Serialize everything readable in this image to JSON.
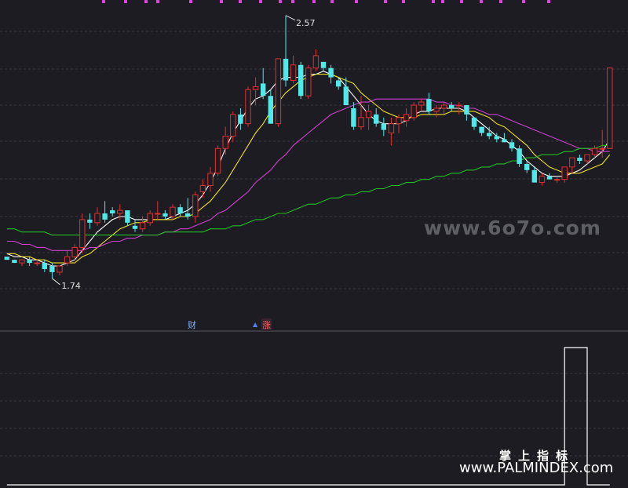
{
  "chart_data": {
    "type": "candlestick",
    "title": "",
    "price_range": [
      1.58,
      2.62
    ],
    "annotations": {
      "high": "2.57",
      "low": "1.74",
      "tags": [
        "财",
        "涨"
      ]
    },
    "candles": [
      [
        1.79,
        1.79,
        1.78,
        1.78
      ],
      [
        1.78,
        1.78,
        1.77,
        1.77
      ],
      [
        1.77,
        1.78,
        1.76,
        1.78
      ],
      [
        1.78,
        1.79,
        1.76,
        1.77
      ],
      [
        1.77,
        1.78,
        1.76,
        1.77
      ],
      [
        1.77,
        1.78,
        1.74,
        1.75
      ],
      [
        1.76,
        1.77,
        1.72,
        1.74
      ],
      [
        1.74,
        1.76,
        1.73,
        1.76
      ],
      [
        1.77,
        1.81,
        1.76,
        1.79
      ],
      [
        1.79,
        1.83,
        1.78,
        1.82
      ],
      [
        1.82,
        1.93,
        1.8,
        1.91
      ],
      [
        1.91,
        1.93,
        1.88,
        1.9
      ],
      [
        1.9,
        1.95,
        1.89,
        1.93
      ],
      [
        1.93,
        1.97,
        1.9,
        1.91
      ],
      [
        1.94,
        1.95,
        1.92,
        1.93
      ],
      [
        1.93,
        1.96,
        1.91,
        1.94
      ],
      [
        1.94,
        1.94,
        1.89,
        1.9
      ],
      [
        1.89,
        1.91,
        1.87,
        1.88
      ],
      [
        1.88,
        1.92,
        1.87,
        1.9
      ],
      [
        1.9,
        1.94,
        1.89,
        1.93
      ],
      [
        1.93,
        1.97,
        1.91,
        1.93
      ],
      [
        1.93,
        1.94,
        1.91,
        1.92
      ],
      [
        1.92,
        1.96,
        1.91,
        1.95
      ],
      [
        1.95,
        1.96,
        1.92,
        1.93
      ],
      [
        1.93,
        1.98,
        1.91,
        1.92
      ],
      [
        1.92,
        2.0,
        1.9,
        1.99
      ],
      [
        2.0,
        2.04,
        1.98,
        2.02
      ],
      [
        2.02,
        2.08,
        2.0,
        2.06
      ],
      [
        2.06,
        2.15,
        2.05,
        2.14
      ],
      [
        2.14,
        2.21,
        2.12,
        2.18
      ],
      [
        2.18,
        2.26,
        2.16,
        2.25
      ],
      [
        2.25,
        2.27,
        2.2,
        2.22
      ],
      [
        2.22,
        2.34,
        2.21,
        2.33
      ],
      [
        2.33,
        2.37,
        2.28,
        2.34
      ],
      [
        2.35,
        2.4,
        2.3,
        2.31
      ],
      [
        2.31,
        2.33,
        2.22,
        2.22
      ],
      [
        2.22,
        2.43,
        2.21,
        2.43
      ],
      [
        2.43,
        2.57,
        2.34,
        2.36
      ],
      [
        2.36,
        2.44,
        2.35,
        2.41
      ],
      [
        2.41,
        2.42,
        2.3,
        2.31
      ],
      [
        2.31,
        2.41,
        2.3,
        2.4
      ],
      [
        2.4,
        2.46,
        2.39,
        2.44
      ],
      [
        2.42,
        2.4,
        2.39,
        2.4
      ],
      [
        2.4,
        2.41,
        2.35,
        2.37
      ],
      [
        2.36,
        2.37,
        2.33,
        2.34
      ],
      [
        2.34,
        2.37,
        2.28,
        2.28
      ],
      [
        2.27,
        2.29,
        2.2,
        2.21
      ],
      [
        2.21,
        2.31,
        2.2,
        2.24
      ],
      [
        2.24,
        2.28,
        2.2,
        2.26
      ],
      [
        2.25,
        2.27,
        2.21,
        2.22
      ],
      [
        2.22,
        2.24,
        2.18,
        2.2
      ],
      [
        2.19,
        2.24,
        2.15,
        2.22
      ],
      [
        2.22,
        2.25,
        2.19,
        2.24
      ],
      [
        2.23,
        2.27,
        2.21,
        2.25
      ],
      [
        2.24,
        2.29,
        2.23,
        2.28
      ],
      [
        2.28,
        2.3,
        2.26,
        2.29
      ],
      [
        2.3,
        2.32,
        2.25,
        2.26
      ],
      [
        2.26,
        2.28,
        2.24,
        2.27
      ],
      [
        2.27,
        2.29,
        2.25,
        2.28
      ],
      [
        2.28,
        2.29,
        2.26,
        2.27
      ],
      [
        2.28,
        2.29,
        2.25,
        2.28
      ],
      [
        2.28,
        2.28,
        2.23,
        2.25
      ],
      [
        2.24,
        2.24,
        2.2,
        2.21
      ],
      [
        2.21,
        2.21,
        2.18,
        2.19
      ],
      [
        2.19,
        2.21,
        2.17,
        2.18
      ],
      [
        2.18,
        2.19,
        2.16,
        2.17
      ],
      [
        2.17,
        2.19,
        2.16,
        2.16
      ],
      [
        2.16,
        2.17,
        2.13,
        2.14
      ],
      [
        2.14,
        2.15,
        2.08,
        2.09
      ],
      [
        2.09,
        2.1,
        2.06,
        2.07
      ],
      [
        2.07,
        2.08,
        2.03,
        2.03
      ],
      [
        2.03,
        2.06,
        2.02,
        2.05
      ],
      [
        2.05,
        2.06,
        2.04,
        2.04
      ],
      [
        2.04,
        2.05,
        2.03,
        2.04
      ],
      [
        2.04,
        2.08,
        2.03,
        2.08
      ],
      [
        2.08,
        2.11,
        2.06,
        2.11
      ],
      [
        2.11,
        2.12,
        2.09,
        2.1
      ],
      [
        2.1,
        2.12,
        2.09,
        2.12
      ],
      [
        2.12,
        2.15,
        2.11,
        2.14
      ],
      [
        2.14,
        2.2,
        2.11,
        2.14
      ],
      [
        2.14,
        2.4,
        2.14,
        2.4
      ]
    ],
    "ma": [
      {
        "color": "#ffffff",
        "values": [
          1.8,
          1.79,
          1.79,
          1.78,
          1.78,
          1.77,
          1.76,
          1.76,
          1.77,
          1.78,
          1.81,
          1.84,
          1.87,
          1.89,
          1.91,
          1.92,
          1.92,
          1.91,
          1.91,
          1.91,
          1.91,
          1.91,
          1.92,
          1.93,
          1.94,
          1.96,
          1.99,
          2.03,
          2.08,
          2.14,
          2.19,
          2.23,
          2.27,
          2.3,
          2.31,
          2.33,
          2.36,
          2.37,
          2.37,
          2.37,
          2.38,
          2.38,
          2.39,
          2.38,
          2.37,
          2.34,
          2.31,
          2.28,
          2.25,
          2.23,
          2.22,
          2.22,
          2.22,
          2.23,
          2.25,
          2.26,
          2.26,
          2.27,
          2.27,
          2.27,
          2.27,
          2.26,
          2.24,
          2.22,
          2.2,
          2.18,
          2.17,
          2.15,
          2.13,
          2.1,
          2.08,
          2.06,
          2.05,
          2.05,
          2.05,
          2.06,
          2.07,
          2.09,
          2.11,
          2.13,
          2.17
        ]
      },
      {
        "color": "#f0e020",
        "values": [
          1.8,
          1.8,
          1.79,
          1.79,
          1.78,
          1.78,
          1.77,
          1.77,
          1.77,
          1.77,
          1.79,
          1.8,
          1.82,
          1.84,
          1.86,
          1.88,
          1.89,
          1.9,
          1.9,
          1.91,
          1.91,
          1.91,
          1.91,
          1.92,
          1.92,
          1.93,
          1.95,
          1.97,
          2.0,
          2.03,
          2.07,
          2.11,
          2.15,
          2.19,
          2.22,
          2.26,
          2.29,
          2.32,
          2.34,
          2.36,
          2.37,
          2.38,
          2.38,
          2.38,
          2.37,
          2.36,
          2.35,
          2.32,
          2.3,
          2.28,
          2.26,
          2.25,
          2.24,
          2.24,
          2.24,
          2.25,
          2.25,
          2.25,
          2.25,
          2.26,
          2.26,
          2.26,
          2.26,
          2.25,
          2.24,
          2.22,
          2.21,
          2.19,
          2.17,
          2.15,
          2.12,
          2.1,
          2.08,
          2.07,
          2.06,
          2.06,
          2.06,
          2.07,
          2.08,
          2.09,
          2.12
        ]
      },
      {
        "color": "#d040d0",
        "values": [
          1.84,
          1.84,
          1.83,
          1.83,
          1.82,
          1.82,
          1.81,
          1.81,
          1.81,
          1.81,
          1.81,
          1.82,
          1.82,
          1.83,
          1.84,
          1.84,
          1.85,
          1.85,
          1.86,
          1.86,
          1.86,
          1.87,
          1.87,
          1.88,
          1.88,
          1.89,
          1.9,
          1.91,
          1.93,
          1.94,
          1.96,
          1.98,
          2.0,
          2.03,
          2.05,
          2.07,
          2.1,
          2.12,
          2.15,
          2.17,
          2.19,
          2.21,
          2.23,
          2.25,
          2.26,
          2.27,
          2.28,
          2.29,
          2.29,
          2.3,
          2.3,
          2.3,
          2.3,
          2.3,
          2.3,
          2.3,
          2.3,
          2.29,
          2.29,
          2.28,
          2.28,
          2.27,
          2.27,
          2.26,
          2.25,
          2.25,
          2.24,
          2.23,
          2.22,
          2.21,
          2.2,
          2.19,
          2.18,
          2.17,
          2.16,
          2.15,
          2.14,
          2.14,
          2.13,
          2.13,
          2.13
        ]
      },
      {
        "color": "#20c020",
        "values": [
          1.88,
          1.88,
          1.87,
          1.87,
          1.87,
          1.87,
          1.86,
          1.86,
          1.86,
          1.86,
          1.86,
          1.86,
          1.86,
          1.86,
          1.86,
          1.86,
          1.86,
          1.86,
          1.86,
          1.86,
          1.86,
          1.87,
          1.87,
          1.87,
          1.87,
          1.87,
          1.87,
          1.88,
          1.88,
          1.88,
          1.89,
          1.89,
          1.9,
          1.91,
          1.91,
          1.92,
          1.93,
          1.93,
          1.94,
          1.95,
          1.96,
          1.96,
          1.97,
          1.98,
          1.98,
          1.99,
          1.99,
          2.0,
          2.0,
          2.01,
          2.01,
          2.02,
          2.02,
          2.03,
          2.03,
          2.04,
          2.04,
          2.05,
          2.05,
          2.06,
          2.06,
          2.07,
          2.07,
          2.08,
          2.08,
          2.09,
          2.09,
          2.1,
          2.1,
          2.11,
          2.11,
          2.12,
          2.12,
          2.12,
          2.13,
          2.13,
          2.14,
          2.14,
          2.14,
          2.15,
          2.15
        ]
      }
    ],
    "indicator": {
      "range": [
        0,
        1
      ],
      "values": [
        0,
        0,
        0,
        0,
        0,
        0,
        0,
        0,
        0,
        0,
        0,
        0,
        0,
        0,
        0,
        0,
        0,
        0,
        0,
        0,
        0,
        0,
        0,
        0,
        0,
        0,
        0,
        0,
        0,
        0,
        0,
        0,
        0,
        0,
        0,
        0,
        0,
        0,
        0,
        0,
        0,
        0,
        0,
        0,
        0,
        0,
        0,
        0,
        0,
        0,
        0,
        0,
        0,
        0,
        0,
        0,
        0,
        0,
        0,
        0,
        0,
        0,
        0,
        0,
        0,
        0,
        0,
        0,
        0,
        0,
        0,
        0,
        0,
        0,
        1,
        1,
        1,
        0,
        0,
        0,
        0
      ]
    },
    "colors": {
      "up": "#e03030",
      "down": "#50e8e8",
      "grid": "#3a3a44",
      "background": "#1c1c22",
      "marker": "#e040e0"
    }
  },
  "watermark": {
    "main": "www.6o7o.com",
    "cn": "掌上指标",
    "url": "www.PALMINDEX.com"
  }
}
